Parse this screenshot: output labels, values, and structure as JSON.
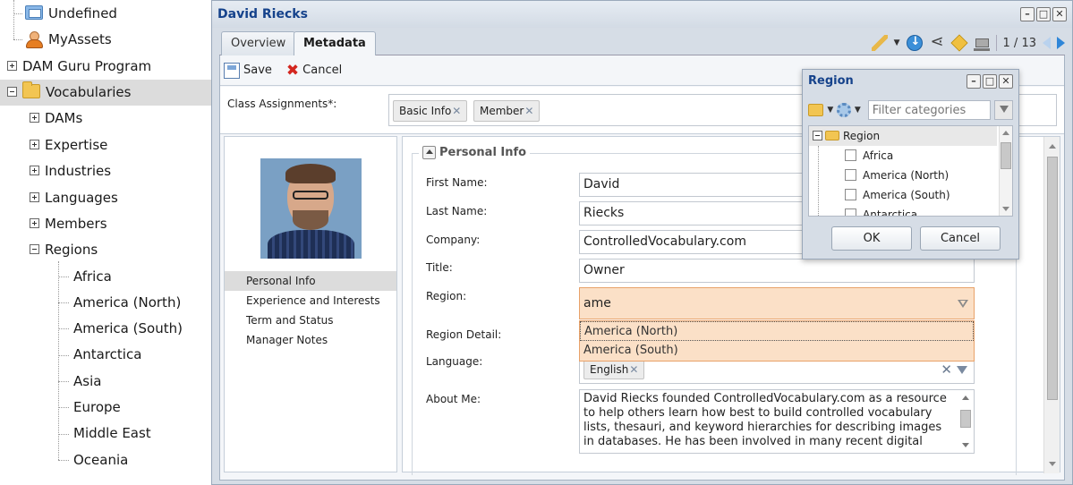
{
  "tree": {
    "items": [
      {
        "label": "Undefined",
        "icon": "folder-blue-icon"
      },
      {
        "label": "MyAssets",
        "icon": "user-icon"
      },
      {
        "label": "DAM Guru Program",
        "icon": "expand-icon"
      },
      {
        "label": "Vocabularies",
        "icon": "folder-icon"
      },
      {
        "label": "DAMs"
      },
      {
        "label": "Expertise"
      },
      {
        "label": "Industries"
      },
      {
        "label": "Languages"
      },
      {
        "label": "Members"
      },
      {
        "label": "Regions"
      },
      {
        "label": "Africa"
      },
      {
        "label": "America (North)"
      },
      {
        "label": "America (South)"
      },
      {
        "label": "Antarctica"
      },
      {
        "label": "Asia"
      },
      {
        "label": "Europe"
      },
      {
        "label": "Middle East"
      },
      {
        "label": "Oceania"
      }
    ]
  },
  "window": {
    "title": "David Riecks",
    "tabs": [
      "Overview",
      "Metadata"
    ],
    "pager": "1 / 13"
  },
  "toolbar": {
    "save": "Save",
    "cancel": "Cancel"
  },
  "class_assignments": {
    "label": "Class Assignments*:",
    "chips": [
      "Basic Info",
      "Member"
    ]
  },
  "side_nav": [
    "Personal Info",
    "Experience and Interests",
    "Term and Status",
    "Manager Notes"
  ],
  "form": {
    "section": "Personal Info",
    "first_name": {
      "label": "First Name:",
      "value": "David"
    },
    "last_name": {
      "label": "Last Name:",
      "value": "Riecks"
    },
    "company": {
      "label": "Company:",
      "value": "ControlledVocabulary.com"
    },
    "title": {
      "label": "Title:",
      "value": "Owner"
    },
    "region": {
      "label": "Region:",
      "value": "ame"
    },
    "region_options": [
      "America (North)",
      "America (South)"
    ],
    "region_detail": {
      "label": "Region Detail:"
    },
    "language": {
      "label": "Language:",
      "chip": "English"
    },
    "about": {
      "label": "About Me:",
      "value": "David Riecks founded ControlledVocabulary.com as a resource to help others learn how best to build controlled vocabulary lists, thesauri, and keyword hierarchies for describing images in databases. He has been involved in many recent digital"
    }
  },
  "popup": {
    "title": "Region",
    "filter_placeholder": "Filter categories",
    "root": "Region",
    "items": [
      "Africa",
      "America (North)",
      "America (South)",
      "Antarctica"
    ],
    "ok": "OK",
    "cancel": "Cancel"
  }
}
